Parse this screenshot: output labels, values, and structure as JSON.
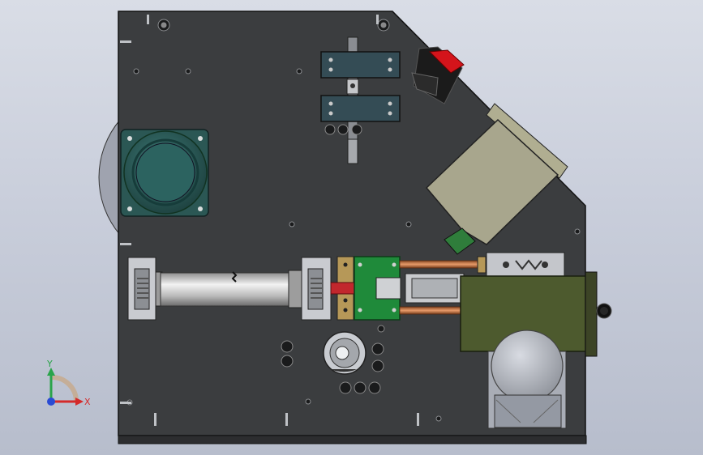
{
  "window": {
    "background_top": "#d9dde6",
    "background_bottom": "#b7bdcc"
  },
  "model": {
    "plate_color": "#3b3d3f",
    "plate_edge": "#1f2021",
    "motor_color": "#2f5f5c",
    "cylinder_color": "#c8c8c8",
    "green_block": "#1f8a3a",
    "red_part": "#c2272d",
    "copper_rod": "#c87a4a",
    "olive_box": "#4d5a2e",
    "beige_box": "#b7b59a",
    "switch_red": "#d4141b"
  },
  "triad": {
    "x_label": "X",
    "y_label": "Y",
    "x_color": "#d42a2a",
    "y_color": "#2aa44a",
    "z_color": "#2a4bd4"
  }
}
